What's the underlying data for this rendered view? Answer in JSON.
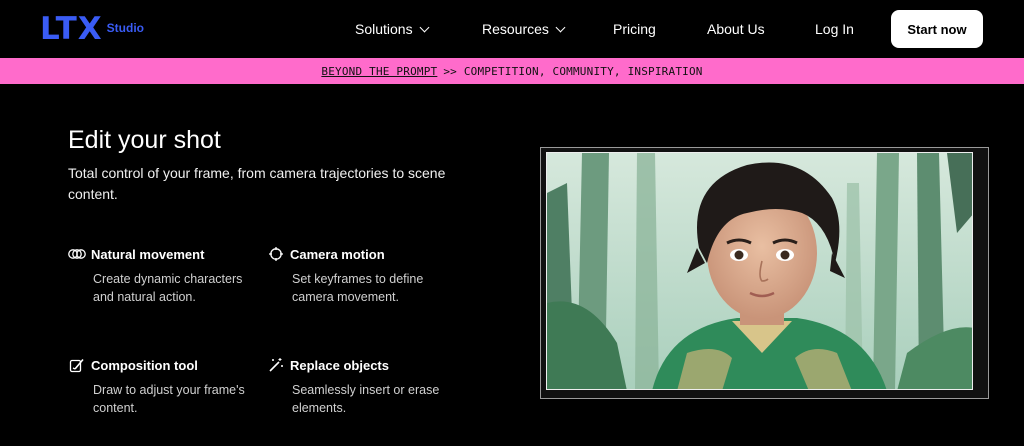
{
  "nav": {
    "logo_mark": "LTX",
    "logo_sub": "Studio",
    "items": [
      {
        "label": "Solutions",
        "has_dropdown": true
      },
      {
        "label": "Resources",
        "has_dropdown": true
      },
      {
        "label": "Pricing",
        "has_dropdown": false
      },
      {
        "label": "About Us",
        "has_dropdown": false
      },
      {
        "label": "Log In",
        "has_dropdown": false
      }
    ],
    "cta_label": "Start now"
  },
  "banner": {
    "link_text": "BEYOND THE PROMPT",
    "rest_text": ">> COMPETITION, COMMUNITY, INSPIRATION",
    "color": "#ff6bcb"
  },
  "hero": {
    "title": "Edit your shot",
    "subtitle": "Total control of your frame, from camera trajectories to scene content.",
    "features": [
      {
        "icon": "natural-movement-icon",
        "title": "Natural movement",
        "desc": "Create dynamic characters and natural action."
      },
      {
        "icon": "camera-motion-icon",
        "title": "Camera motion",
        "desc": "Set keyframes to define camera movement."
      },
      {
        "icon": "composition-tool-icon",
        "title": "Composition tool",
        "desc": "Draw to adjust your frame's content."
      },
      {
        "icon": "replace-objects-icon",
        "title": "Replace objects",
        "desc": "Seamlessly insert or erase elements."
      }
    ]
  },
  "colors": {
    "accent": "#3a5cf5",
    "background": "#000000"
  }
}
